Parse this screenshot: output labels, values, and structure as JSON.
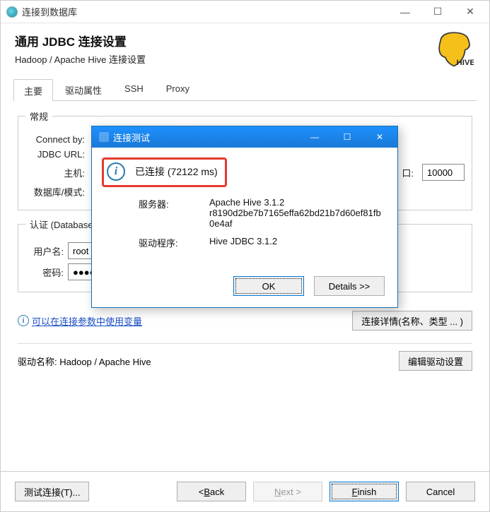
{
  "window": {
    "title": "连接到数据库"
  },
  "header": {
    "title": "通用 JDBC 连接设置",
    "subtitle": "Hadoop / Apache Hive 连接设置"
  },
  "tabs": [
    {
      "label": "主要",
      "active": true
    },
    {
      "label": "驱动属性",
      "active": false
    },
    {
      "label": "SSH",
      "active": false
    },
    {
      "label": "Proxy",
      "active": false
    }
  ],
  "groups": {
    "general": {
      "legend": "常规",
      "connect_by_label": "Connect by:",
      "url_label": "JDBC URL:",
      "host_label": "主机:",
      "port_label": "口:",
      "port_value": "10000",
      "db_label": "数据库/模式:"
    },
    "auth": {
      "legend": "认证 (Database",
      "user_label": "用户名:",
      "user_value": "root",
      "pwd_label": "密码:",
      "pwd_value": "●●●●"
    }
  },
  "link_text": "可以在连接参数中使用变量",
  "conn_details_btn": "连接详情(名称、类型 ... )",
  "driver_label": "驱动名称:",
  "driver_value": "Hadoop / Apache Hive",
  "edit_driver_btn": "编辑驱动设置",
  "buttons": {
    "test": "测试连接(T)...",
    "back": "< Back",
    "next": "Next >",
    "finish": "Finish",
    "cancel": "Cancel"
  },
  "modal": {
    "title": "连接测试",
    "message": "已连接 (72122 ms)",
    "server_label": "服务器:",
    "server_value": "Apache Hive 3.1.2",
    "server_hash": "r8190d2be7b7165effa62bd21b7d60ef81fb0e4af",
    "driver_label": "驱动程序:",
    "driver_value": "Hive JDBC 3.1.2",
    "ok": "OK",
    "details": "Details >>"
  }
}
